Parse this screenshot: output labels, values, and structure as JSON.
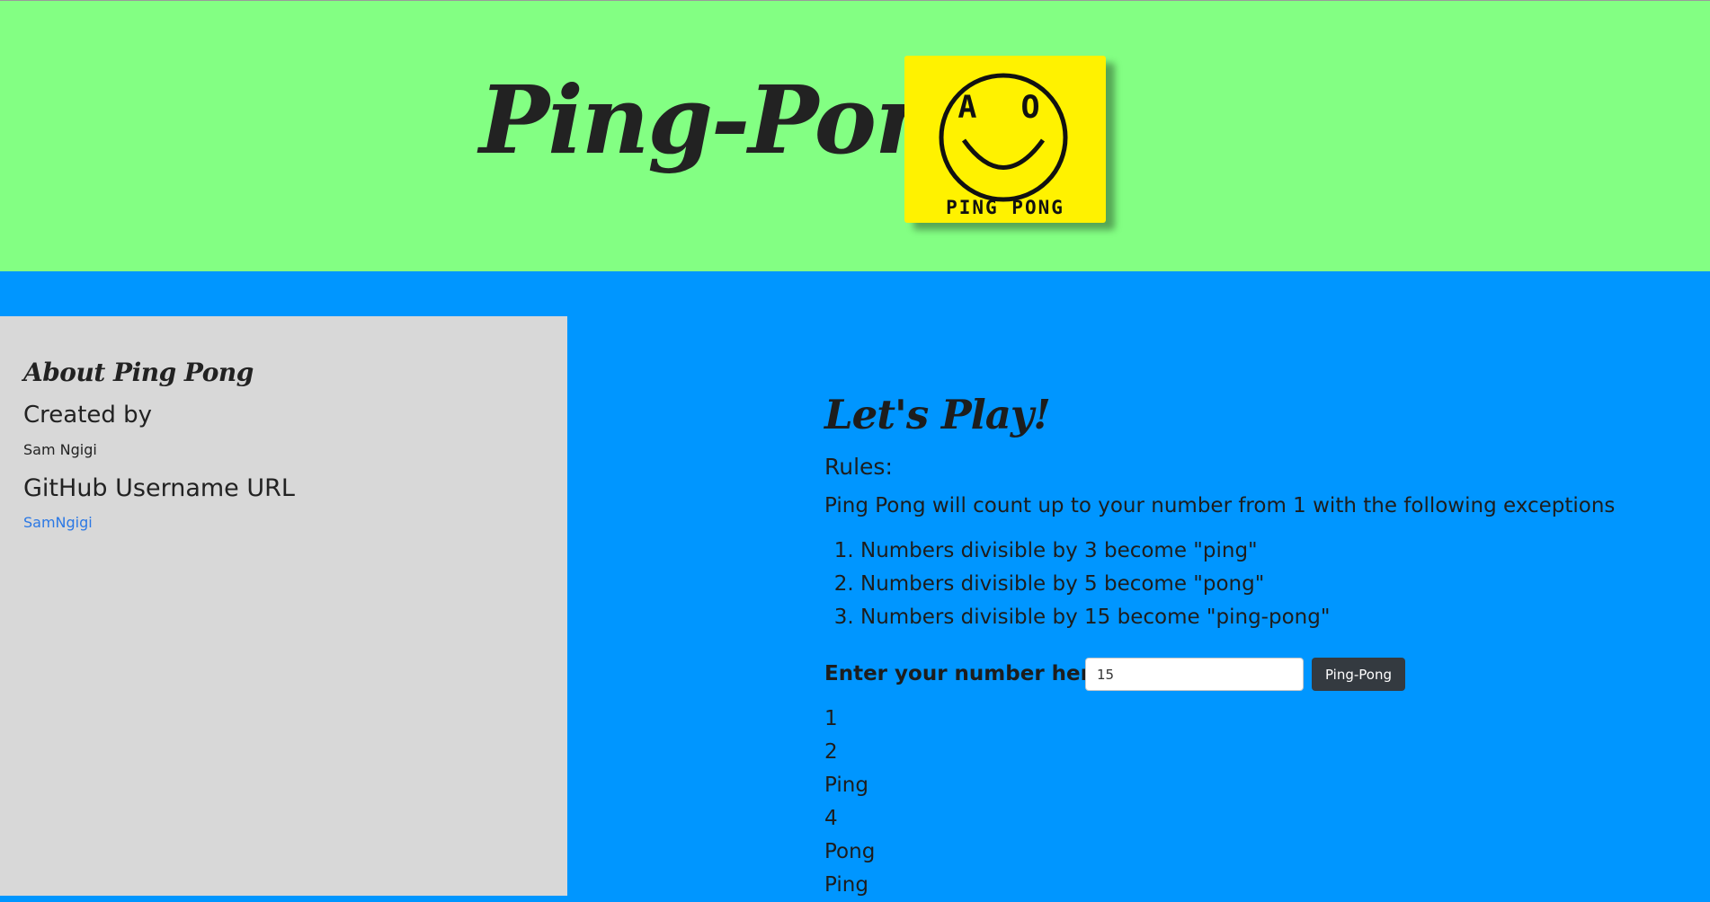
{
  "header": {
    "title": "Ping-Pong",
    "logo": {
      "eyes_text": "A O",
      "caption": "PING PONG",
      "background_color": "#fff200"
    },
    "background_color": "#83ff83"
  },
  "page_background_color": "#0096ff",
  "sidebar": {
    "heading": "About Ping Pong",
    "created_by_label": "Created by",
    "author": "Sam Ngigi",
    "github_label": "GitHub Username URL",
    "github_link_text": "SamNgigi",
    "background_color": "#d8d8d8"
  },
  "main": {
    "heading": "Let's Play!",
    "rules_label": "Rules:",
    "rules_intro": "Ping Pong will count up to your number from 1 with the following exceptions",
    "rules": [
      "Numbers divisible by 3 become \"ping\"",
      "Numbers divisible by 5 become \"pong\"",
      "Numbers divisible by 15 become \"ping-pong\""
    ],
    "form": {
      "label": "Enter your number here:",
      "input_value": "15",
      "button_label": "Ping-Pong"
    },
    "results": [
      "1",
      "2",
      "Ping",
      "4",
      "Pong",
      "Ping"
    ]
  }
}
